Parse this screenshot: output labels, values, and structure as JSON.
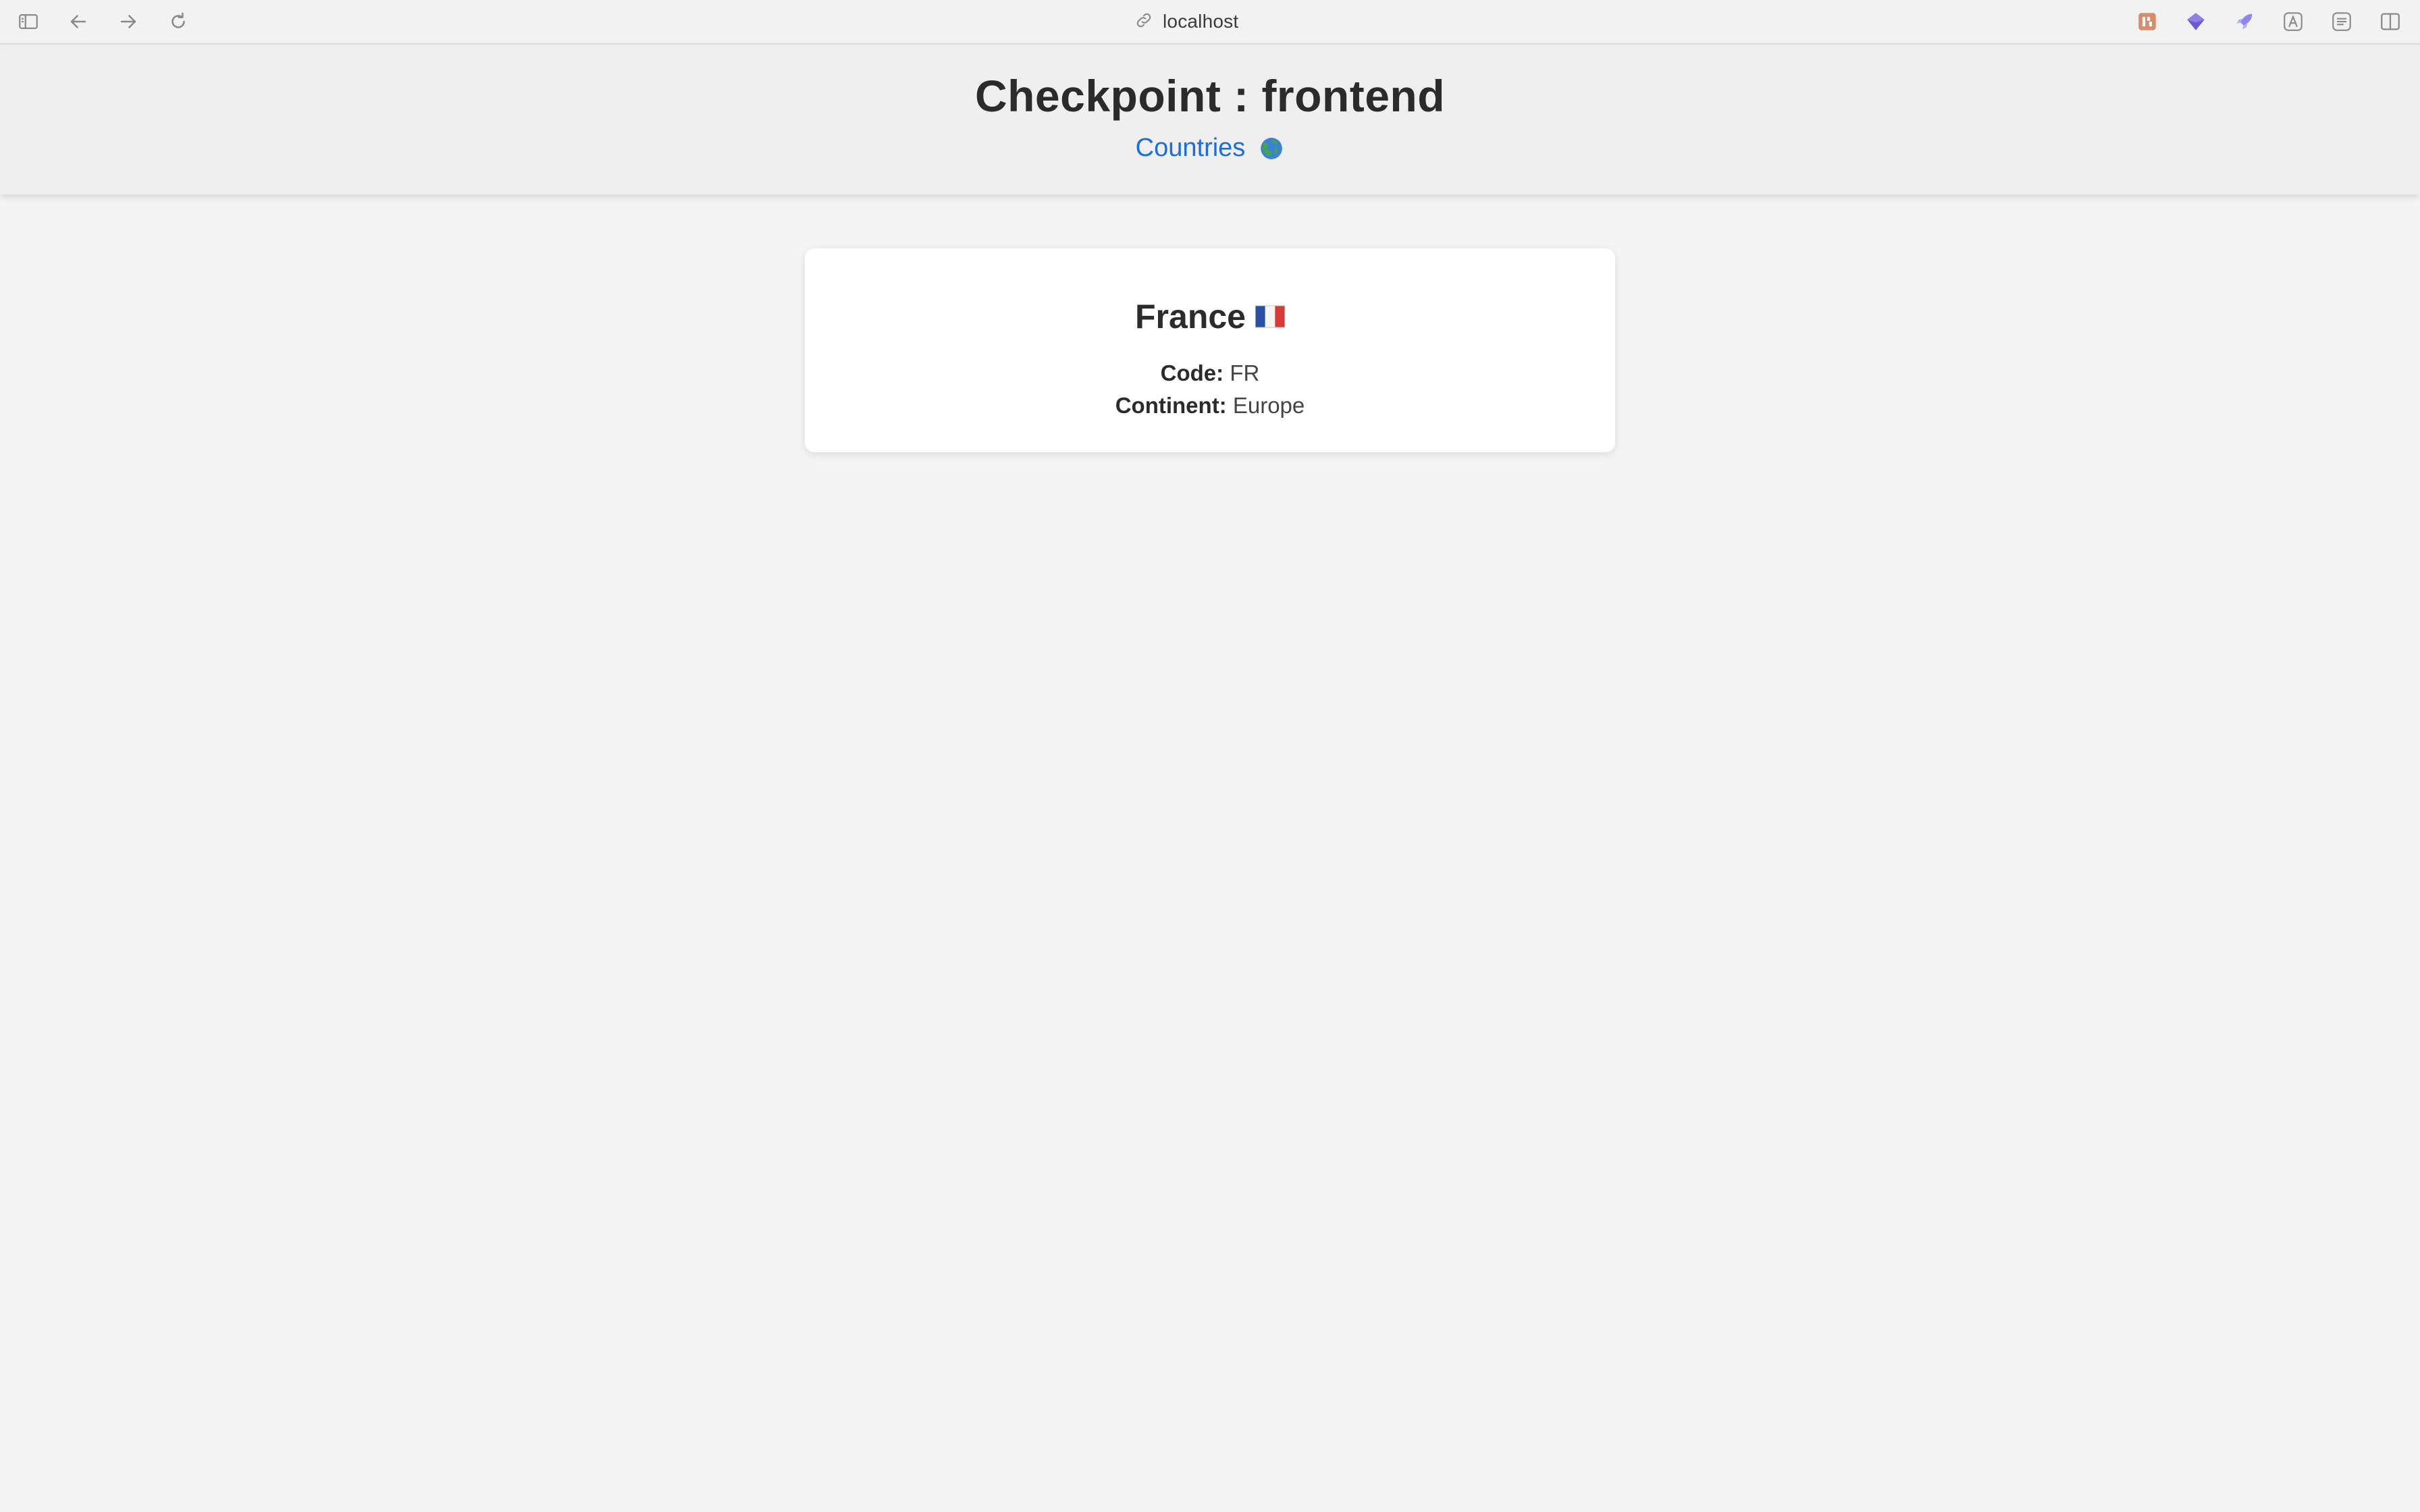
{
  "browser": {
    "address": "localhost",
    "extensions": [
      "extension-tile-icon",
      "extension-diamond-icon",
      "extension-rocket-icon",
      "extension-translate-icon",
      "extension-list-icon",
      "split-view-icon"
    ]
  },
  "header": {
    "title": "Checkpoint : frontend",
    "nav": {
      "countries_label": "Countries",
      "countries_icon": "globe-icon"
    }
  },
  "country_card": {
    "name": "France",
    "flag_icon": "france-flag-icon",
    "code_label": "Code:",
    "code_value": "FR",
    "continent_label": "Continent:",
    "continent_value": "Europe"
  },
  "colors": {
    "page_background": "#f4f4f4",
    "header_background": "#efefef",
    "link": "#1a6de0",
    "card_background": "#ffffff",
    "text": "#2b2b2b"
  }
}
